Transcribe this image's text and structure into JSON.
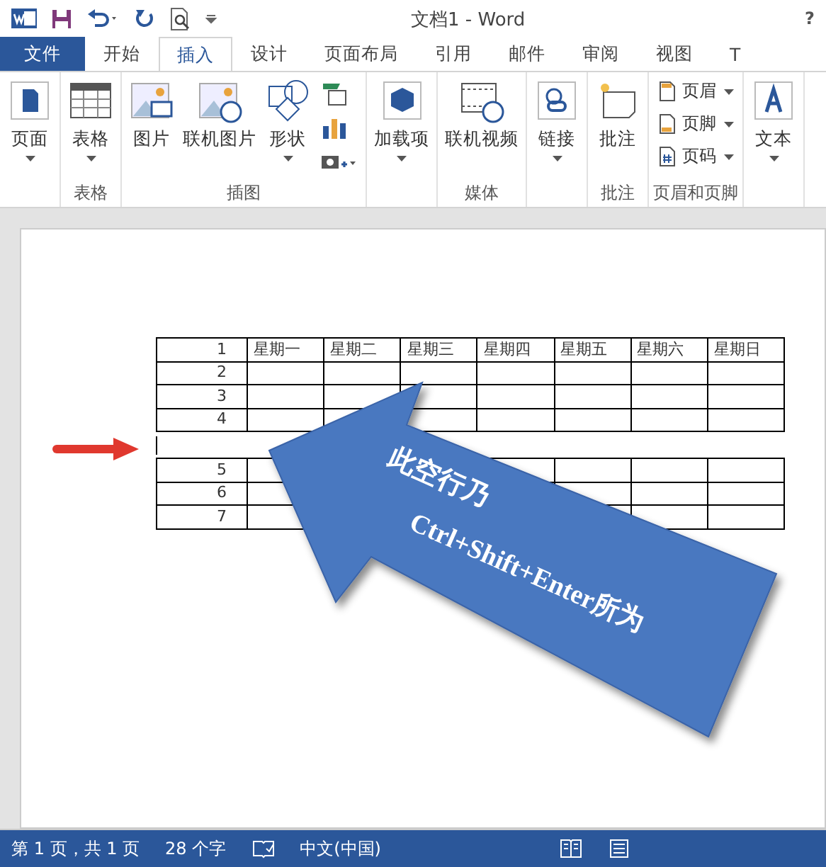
{
  "window": {
    "title": "文档1 - Word",
    "help": "?"
  },
  "tabs": [
    {
      "label": "文件",
      "kind": "file",
      "selected": false
    },
    {
      "label": "开始",
      "kind": "tab",
      "selected": false
    },
    {
      "label": "插入",
      "kind": "tab",
      "selected": true
    },
    {
      "label": "设计",
      "kind": "tab",
      "selected": false
    },
    {
      "label": "页面布局",
      "kind": "tab",
      "selected": false
    },
    {
      "label": "引用",
      "kind": "tab",
      "selected": false
    },
    {
      "label": "邮件",
      "kind": "tab",
      "selected": false
    },
    {
      "label": "审阅",
      "kind": "tab",
      "selected": false
    },
    {
      "label": "视图",
      "kind": "tab",
      "selected": false
    },
    {
      "label": "T",
      "kind": "tab",
      "selected": false
    }
  ],
  "ribbon": {
    "groups": [
      {
        "items": [
          {
            "kind": "large",
            "label": "页面",
            "dropdown": true
          }
        ]
      },
      {
        "label": "表格",
        "items": [
          {
            "kind": "large",
            "label": "表格",
            "dropdown": true
          }
        ]
      },
      {
        "label": "插图",
        "items": [
          {
            "kind": "large",
            "label": "图片",
            "dropdown": false
          },
          {
            "kind": "large",
            "label": "联机图片",
            "dropdown": false
          },
          {
            "kind": "large",
            "label": "形状",
            "dropdown": true
          },
          {
            "kind": "stack",
            "dropdown": true
          }
        ]
      },
      {
        "items": [
          {
            "kind": "large",
            "label": "加载项",
            "dropdown": true
          }
        ]
      },
      {
        "label": "媒体",
        "items": [
          {
            "kind": "large",
            "label": "联机视频",
            "dropdown": false
          }
        ]
      },
      {
        "items": [
          {
            "kind": "large",
            "label": "链接",
            "dropdown": true
          }
        ]
      },
      {
        "label": "批注",
        "items": [
          {
            "kind": "large",
            "label": "批注",
            "dropdown": false
          }
        ]
      },
      {
        "label": "页眉和页脚",
        "items": [
          {
            "kind": "small",
            "label": "页眉",
            "dropdown": true
          },
          {
            "kind": "small",
            "label": "页脚",
            "dropdown": true
          },
          {
            "kind": "small",
            "label": "页码",
            "dropdown": true
          }
        ]
      },
      {
        "items": [
          {
            "kind": "large",
            "label": "文本",
            "dropdown": true
          }
        ]
      }
    ]
  },
  "table": {
    "rows": [
      {
        "number": "1",
        "cells": [
          "星期一",
          "星期二",
          "星期三",
          "星期四",
          "星期五",
          "星期六",
          "星期日"
        ]
      },
      {
        "number": "2"
      },
      {
        "number": "3"
      },
      {
        "number": "4"
      }
    ],
    "rows_after_break": [
      {
        "number": "5"
      },
      {
        "number": "6"
      },
      {
        "number": "7"
      }
    ]
  },
  "callout": {
    "lines": [
      "此空行乃",
      "Ctrl+Shift+Enter所为"
    ]
  },
  "status_bar": {
    "page": "第 1 页，共 1 页",
    "words": "28 个字",
    "language": "中文(中国)"
  }
}
